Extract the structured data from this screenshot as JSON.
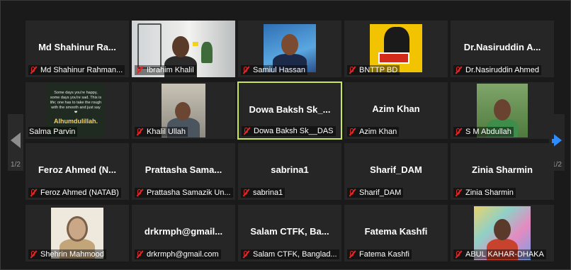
{
  "pager": {
    "left_page": "1/2",
    "right_page": "1/2"
  },
  "tiles": [
    {
      "name": "Md Shahinur Ra...",
      "label": "Md Shahinur Rahman..."
    },
    {
      "name": "",
      "label": "Ibrahim Khalil"
    },
    {
      "name": "",
      "label": "Samiul Hassan"
    },
    {
      "name": "",
      "label": "BNTTP BD"
    },
    {
      "name": "Dr.Nasiruddin A...",
      "label": "Dr.Nasiruddin Ahmed"
    },
    {
      "name": "",
      "label": "Salma Parvin",
      "overlay_text": "Some days you're happy, some days you're sad. This is life; one has to take the rough with the smooth and just say ❤",
      "overlay_caption": "Alhumdulillah."
    },
    {
      "name": "",
      "label": "Khalil Ullah"
    },
    {
      "name": "Dowa Baksh Sk_...",
      "label": "Dowa Baksh Sk__DAS"
    },
    {
      "name": "Azim Khan",
      "label": "Azim Khan"
    },
    {
      "name": "",
      "label": "S M Abdullah"
    },
    {
      "name": "Feroz Ahmed (N...",
      "label": "Feroz Ahmed (NATAB)"
    },
    {
      "name": "Prattasha Sama...",
      "label": "Prattasha Samazik Un..."
    },
    {
      "name": "sabrina1",
      "label": "sabrina1"
    },
    {
      "name": "Sharif_DAM",
      "label": "Sharif_DAM"
    },
    {
      "name": "Zinia Sharmin",
      "label": "Zinia Sharmin"
    },
    {
      "name": "",
      "label": "Shehrin Mahmood"
    },
    {
      "name": "drkrmph@gmail...",
      "label": "drkrmph@gmail.com"
    },
    {
      "name": "Salam CTFK, Ba...",
      "label": "Salam CTFK, Banglad..."
    },
    {
      "name": "Fatema Kashfi",
      "label": "Fatema Kashfi"
    },
    {
      "name": "",
      "label": "ABUL KAHAR-DHAKA"
    }
  ],
  "colors": {
    "active_border": "#c8e65c",
    "muted_icon": "#e02828",
    "next_arrow": "#2d8cff"
  }
}
